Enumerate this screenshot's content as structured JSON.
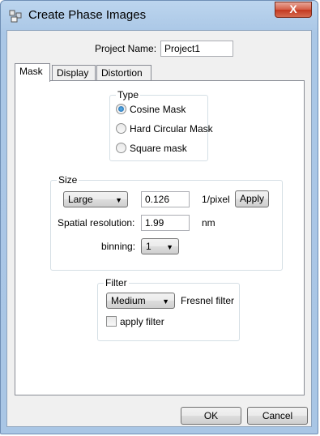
{
  "window": {
    "title": "Create Phase Images",
    "close_glyph": "X",
    "app_icon": "app-icon"
  },
  "project": {
    "label": "Project Name:",
    "value": "Project1"
  },
  "tabs": [
    {
      "label": "Mask",
      "active": true
    },
    {
      "label": "Display",
      "active": false
    },
    {
      "label": "Distortion",
      "active": false
    }
  ],
  "type_group": {
    "title": "Type",
    "options": [
      {
        "label": "Cosine Mask",
        "checked": true
      },
      {
        "label": "Hard Circular Mask",
        "checked": false
      },
      {
        "label": "Square mask",
        "checked": false
      }
    ]
  },
  "size_group": {
    "title": "Size",
    "size_select": "Large",
    "value": "0.126",
    "unit": "1/pixel",
    "apply_label": "Apply",
    "spatial_label": "Spatial resolution:",
    "spatial_value": "1.99",
    "spatial_unit": "nm",
    "binning_label": "binning:",
    "binning_value": "1"
  },
  "filter_group": {
    "title": "Filter",
    "filter_select": "Medium",
    "filter_name": "Fresnel filter",
    "apply_filter_label": "apply filter",
    "apply_filter_checked": false
  },
  "footer": {
    "ok_label": "OK",
    "cancel_label": "Cancel"
  }
}
